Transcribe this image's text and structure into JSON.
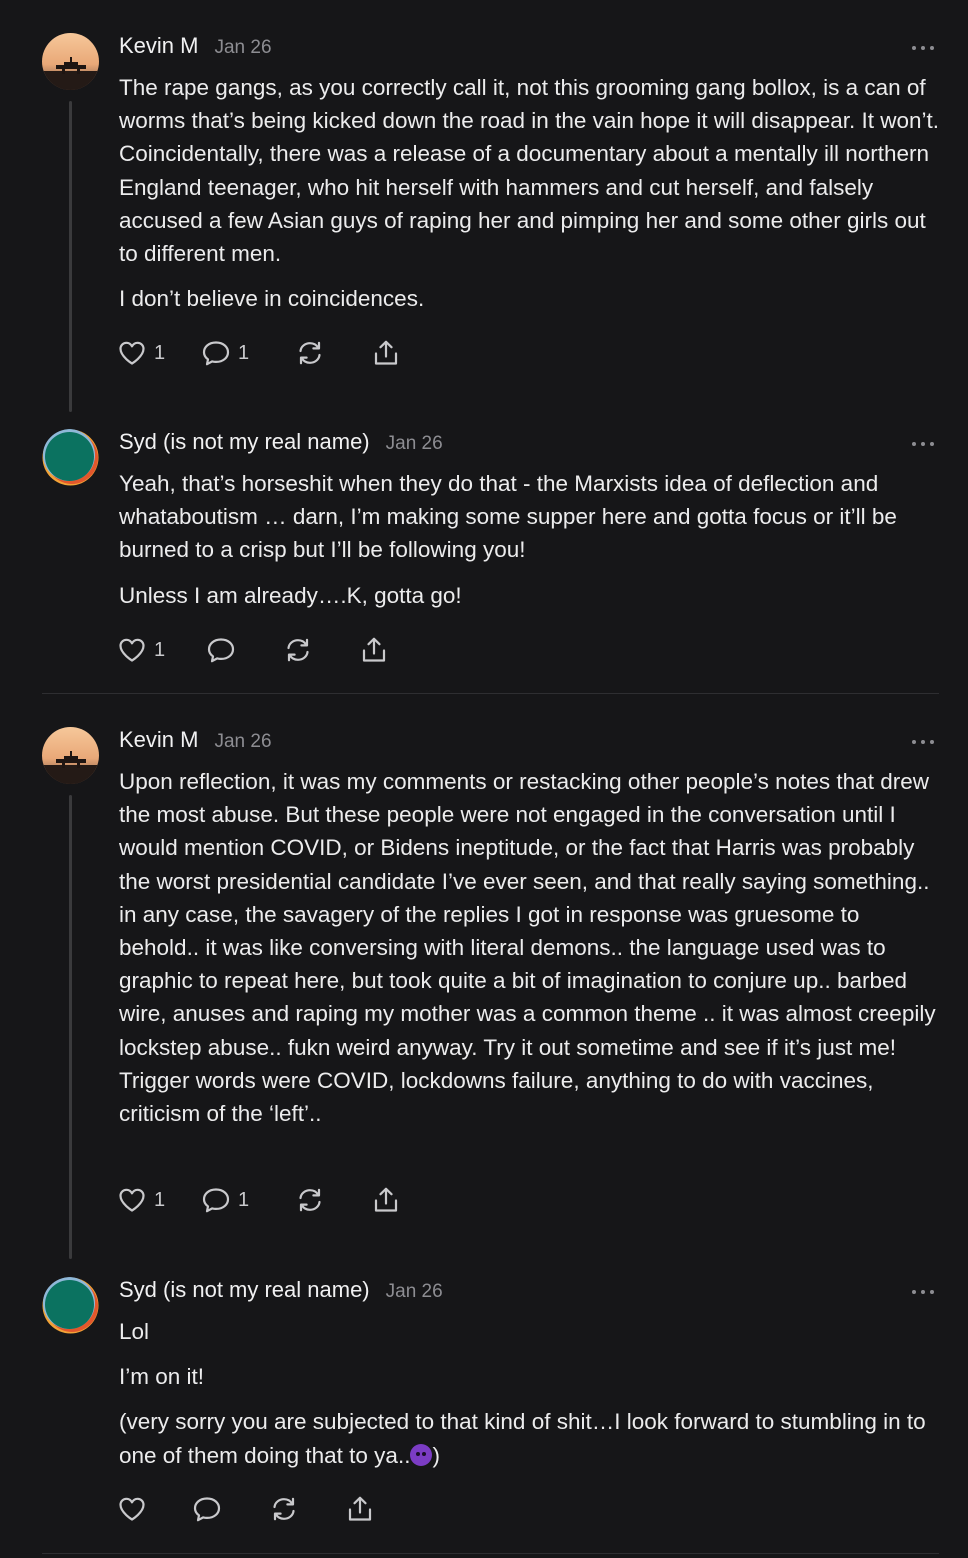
{
  "posts": [
    {
      "author": "Kevin M",
      "date": "Jan 26",
      "avatar": "sunset-avatar",
      "paragraphs": [
        "The rape gangs, as you correctly call it, not this grooming gang bollox, is a can of worms that’s being kicked down the road in the vain hope it will disappear. It won’t. Coincidentally, there was a release of a documentary about a mentally ill northern England teenager, who hit herself with hammers and cut herself, and falsely accused a few Asian guys of raping her and pimping her and some other girls out to different men.",
        "I don’t believe in coincidences."
      ],
      "likes": "1",
      "comments": "1"
    },
    {
      "author": "Syd (is not my real name)",
      "date": "Jan 26",
      "avatar": "globe-avatar",
      "paragraphs": [
        "Yeah, that’s horseshit when they do that - the Marxists idea of deflection and whataboutism … darn, I’m making some supper here and gotta focus or it’ll be burned to a crisp but I’ll be following you!",
        "Unless I am already….K, gotta go!"
      ],
      "likes": "1",
      "comments": ""
    },
    {
      "author": "Kevin M",
      "date": "Jan 26",
      "avatar": "sunset-avatar",
      "paragraphs": [
        "Upon reflection, it was my comments or restacking other people’s notes that drew the most abuse. But these people were not engaged in the conversation until I would mention COVID, or Bidens ineptitude, or the fact that Harris was probably the worst presidential candidate I’ve ever seen, and that really saying something.. in any case, the savagery of the replies I got in response was gruesome to behold.. it was like conversing with literal demons.. the language used was to graphic to repeat here, but took quite a bit of imagination to conjure up.. barbed wire, anuses and raping my mother was a common theme .. it was almost creepily lockstep abuse.. fukn weird anyway. Try it out sometime and see if it’s just me! Trigger words were COVID, lockdowns failure, anything to do with vaccines, criticism of the ‘left’.."
      ],
      "likes": "1",
      "comments": "1"
    },
    {
      "author": "Syd (is not my real name)",
      "date": "Jan 26",
      "avatar": "globe-avatar",
      "paragraphs": [
        "Lol",
        "I’m on it!",
        "(very sorry you are subjected to that kind of shit…I look forward to stumbling in to one of them doing that to ya..",
        ")"
      ],
      "emoji": "smiling-devil-emoji",
      "likes": "",
      "comments": ""
    }
  ],
  "icons": {
    "like": "heart-icon",
    "comment": "comment-bubble-icon",
    "restack": "restack-arrows-icon",
    "share": "share-upload-icon",
    "more": "more-dots-icon"
  },
  "colors": {
    "background": "#161618",
    "text": "#ececed",
    "muted": "#8d8d92",
    "thread_line": "#3a3a3c"
  }
}
